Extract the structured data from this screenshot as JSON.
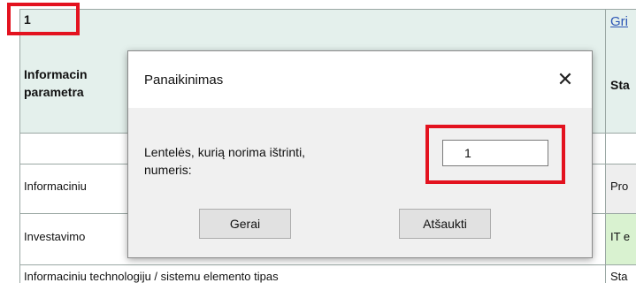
{
  "sheet": {
    "cell_number": "1",
    "link_text": "Gri",
    "header_left_line1": "Informacin",
    "header_left_line2": "parametra",
    "header_right": "Sta",
    "row1_left": "Informaciniu",
    "row1_right": "Pro",
    "row2_left": "Investavimo",
    "row2_right": "IT e",
    "row3_left": "Informaciniu technologiju / sistemu elemento tipas",
    "row3_right": "Sta"
  },
  "dialog": {
    "title": "Panaikinimas",
    "close_glyph": "✕",
    "prompt_line1": "Lentelės, kurią norima ištrinti,",
    "prompt_line2": "numeris:",
    "input_value": "1",
    "ok_label": "Gerai",
    "cancel_label": "Atšaukti"
  }
}
